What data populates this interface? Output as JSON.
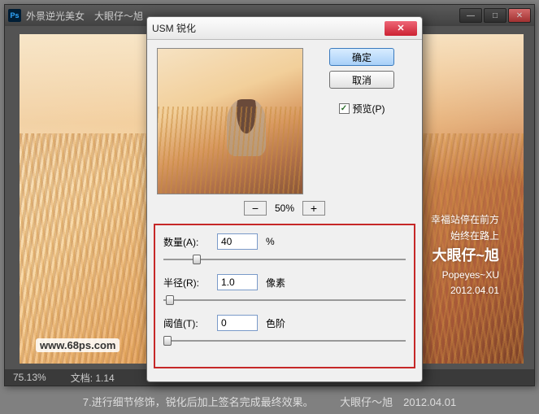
{
  "ps": {
    "icon": "Ps",
    "title": "外景逆光美女　大眼仔～旭",
    "zoom": "75.13%",
    "doc": "文档: 1.14",
    "watermark": "www.68ps.com",
    "side": {
      "l1": "幸福站停在前方",
      "l2": "始终在路上",
      "l3": "大眼仔~旭",
      "l4": "Popeyes~XU",
      "l5": "2012.04.01"
    }
  },
  "dlg": {
    "title": "USM 锐化",
    "ok": "确定",
    "cancel": "取消",
    "preview": "预览(P)",
    "zoom_out": "−",
    "zoom_pct": "50%",
    "zoom_in": "+",
    "amount": {
      "label": "数量(A):",
      "value": "40",
      "unit": "%"
    },
    "radius": {
      "label": "半径(R):",
      "value": "1.0",
      "unit": "像素"
    },
    "threshold": {
      "label": "阈值(T):",
      "value": "0",
      "unit": "色阶"
    }
  },
  "caption": "7.进行细节修饰，锐化后加上签名完成最终效果。　　　大眼仔～旭　2012.04.01"
}
